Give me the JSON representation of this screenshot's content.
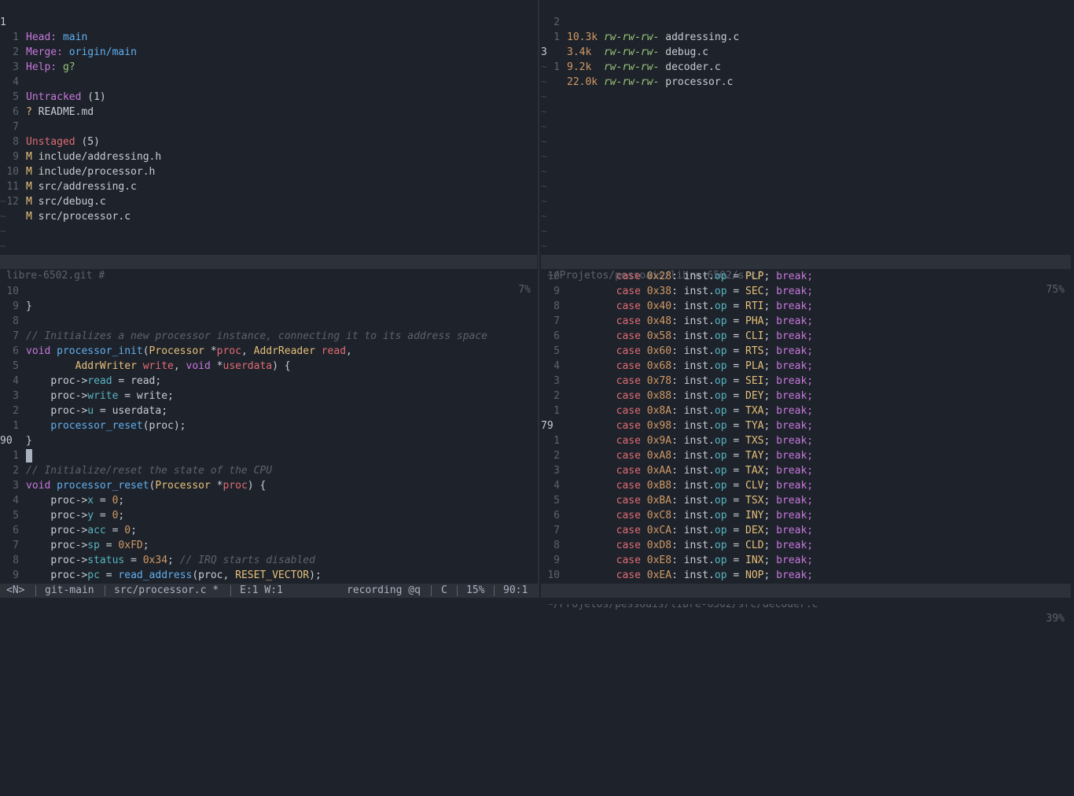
{
  "git_status": {
    "lines": [
      {
        "num": "1",
        "cur": true,
        "label": "Head:",
        "value": "main"
      },
      {
        "num": "1",
        "label": "Merge:",
        "value": "origin/main"
      },
      {
        "num": "2",
        "label": "Help:",
        "value": "g?"
      },
      {
        "num": "3"
      },
      {
        "num": "4",
        "section": "Untracked",
        "count": "(1)"
      },
      {
        "num": "5",
        "mark": "?",
        "file": "README.md"
      },
      {
        "num": "6"
      },
      {
        "num": "7",
        "section": "Unstaged",
        "count": "(5)"
      },
      {
        "num": "8",
        "mark": "M",
        "file": "include/addressing.h"
      },
      {
        "num": "9",
        "mark": "M",
        "file": "include/processor.h"
      },
      {
        "num": "10",
        "mark": "M",
        "file": "src/addressing.c"
      },
      {
        "num": "11",
        "mark": "M",
        "file": "src/debug.c"
      },
      {
        "num": "12",
        "mark": "M",
        "file": "src/processor.c"
      }
    ],
    "status_left": "libre-6502.git #",
    "status_right": "7%"
  },
  "file_browser": {
    "entries": [
      {
        "num": "2",
        "size": "10.3k",
        "perm": "rw-rw-rw-",
        "name": "addressing.c"
      },
      {
        "num": "1",
        "size": "3.4k",
        "perm": "rw-rw-rw-",
        "name": "debug.c"
      },
      {
        "num": "3",
        "cur": true,
        "size": "9.2k",
        "perm": "rw-rw-rw-",
        "name": "decoder.c"
      },
      {
        "num": "1",
        "size": "22.0k",
        "perm": "rw-rw-rw-",
        "name": "processor.c"
      }
    ],
    "status_left": "~/Projetos/pessoais/libre-6502/src/",
    "status_right": "75%"
  },
  "processor_c": {
    "line_numbers": [
      "10",
      "9",
      "8",
      "7",
      "6",
      "5",
      "4",
      "3",
      "2",
      "1",
      "90",
      "1",
      "2",
      "3",
      "4",
      "5",
      "6",
      "7",
      "8",
      "9",
      "10"
    ],
    "texts": {
      "brace_close": "}",
      "comment1": "// Initializes a new processor instance, connecting it to its address space",
      "kw_void": "void",
      "fn_init": "processor_init",
      "type_processor": "Processor",
      "star_proc": "*",
      "param_proc": "proc",
      "type_addrreader": "AddrReader",
      "param_read": "read",
      "type_addrwriter": "AddrWriter",
      "param_write": "write",
      "kw_void2": "void",
      "param_userdata": "userdata",
      "stmt_read_pre": "proc->",
      "member_read": "read",
      "stmt_read_post": " = read;",
      "member_write": "write",
      "stmt_write_post": " = write;",
      "member_u": "u",
      "stmt_u_post": " = userdata;",
      "fn_reset_call": "processor_reset",
      "call_args": "(proc);",
      "comment2": "// Initialize/reset the state of the CPU",
      "fn_reset": "processor_reset",
      "member_x": "x",
      "member_y": "y",
      "member_acc": "acc",
      "member_sp": "sp",
      "member_status": "status",
      "member_pc": "pc",
      "zero": "0",
      "hex_fd": "0xFD",
      "hex_34": "0x34",
      "comment3": "// IRQ starts disabled",
      "fn_read_address": "read_address",
      "const_reset_vector": "RESET_VECTOR"
    }
  },
  "decoder_c": {
    "rows": [
      {
        "num": "10",
        "hex": "0x28",
        "op": "PLP"
      },
      {
        "num": "9",
        "hex": "0x38",
        "op": "SEC"
      },
      {
        "num": "8",
        "hex": "0x40",
        "op": "RTI"
      },
      {
        "num": "7",
        "hex": "0x48",
        "op": "PHA"
      },
      {
        "num": "6",
        "hex": "0x58",
        "op": "CLI"
      },
      {
        "num": "5",
        "hex": "0x60",
        "op": "RTS"
      },
      {
        "num": "4",
        "hex": "0x68",
        "op": "PLA"
      },
      {
        "num": "3",
        "hex": "0x78",
        "op": "SEI"
      },
      {
        "num": "2",
        "hex": "0x88",
        "op": "DEY"
      },
      {
        "num": "1",
        "hex": "0x8A",
        "op": "TXA"
      },
      {
        "num": "79",
        "cur": true,
        "hex": "0x98",
        "op": "TYA"
      },
      {
        "num": "1",
        "hex": "0x9A",
        "op": "TXS"
      },
      {
        "num": "2",
        "hex": "0xA8",
        "op": "TAY"
      },
      {
        "num": "3",
        "hex": "0xAA",
        "op": "TAX"
      },
      {
        "num": "4",
        "hex": "0xB8",
        "op": "CLV"
      },
      {
        "num": "5",
        "hex": "0xBA",
        "op": "TSX"
      },
      {
        "num": "6",
        "hex": "0xC8",
        "op": "INY"
      },
      {
        "num": "7",
        "hex": "0xCA",
        "op": "DEX"
      },
      {
        "num": "8",
        "hex": "0xD8",
        "op": "CLD"
      },
      {
        "num": "9",
        "hex": "0xE8",
        "op": "INX"
      },
      {
        "num": "10",
        "hex": "0xEA",
        "op": "NOP"
      }
    ],
    "kw_case": "case",
    "inst": "inst.",
    "member_op": "op",
    "kw_break": "break;",
    "status_left": "~/Projetos/pessoais/libre-6502/src/decoder.c",
    "status_right": "39%"
  },
  "statusline": {
    "mode": "<N>",
    "branch": "git-main",
    "file": "src/processor.c *",
    "diagnostics": "E:1 W:1",
    "recording": "recording @q",
    "filetype": "C",
    "percent": "15%",
    "position": "90:1"
  },
  "tilde": "~"
}
